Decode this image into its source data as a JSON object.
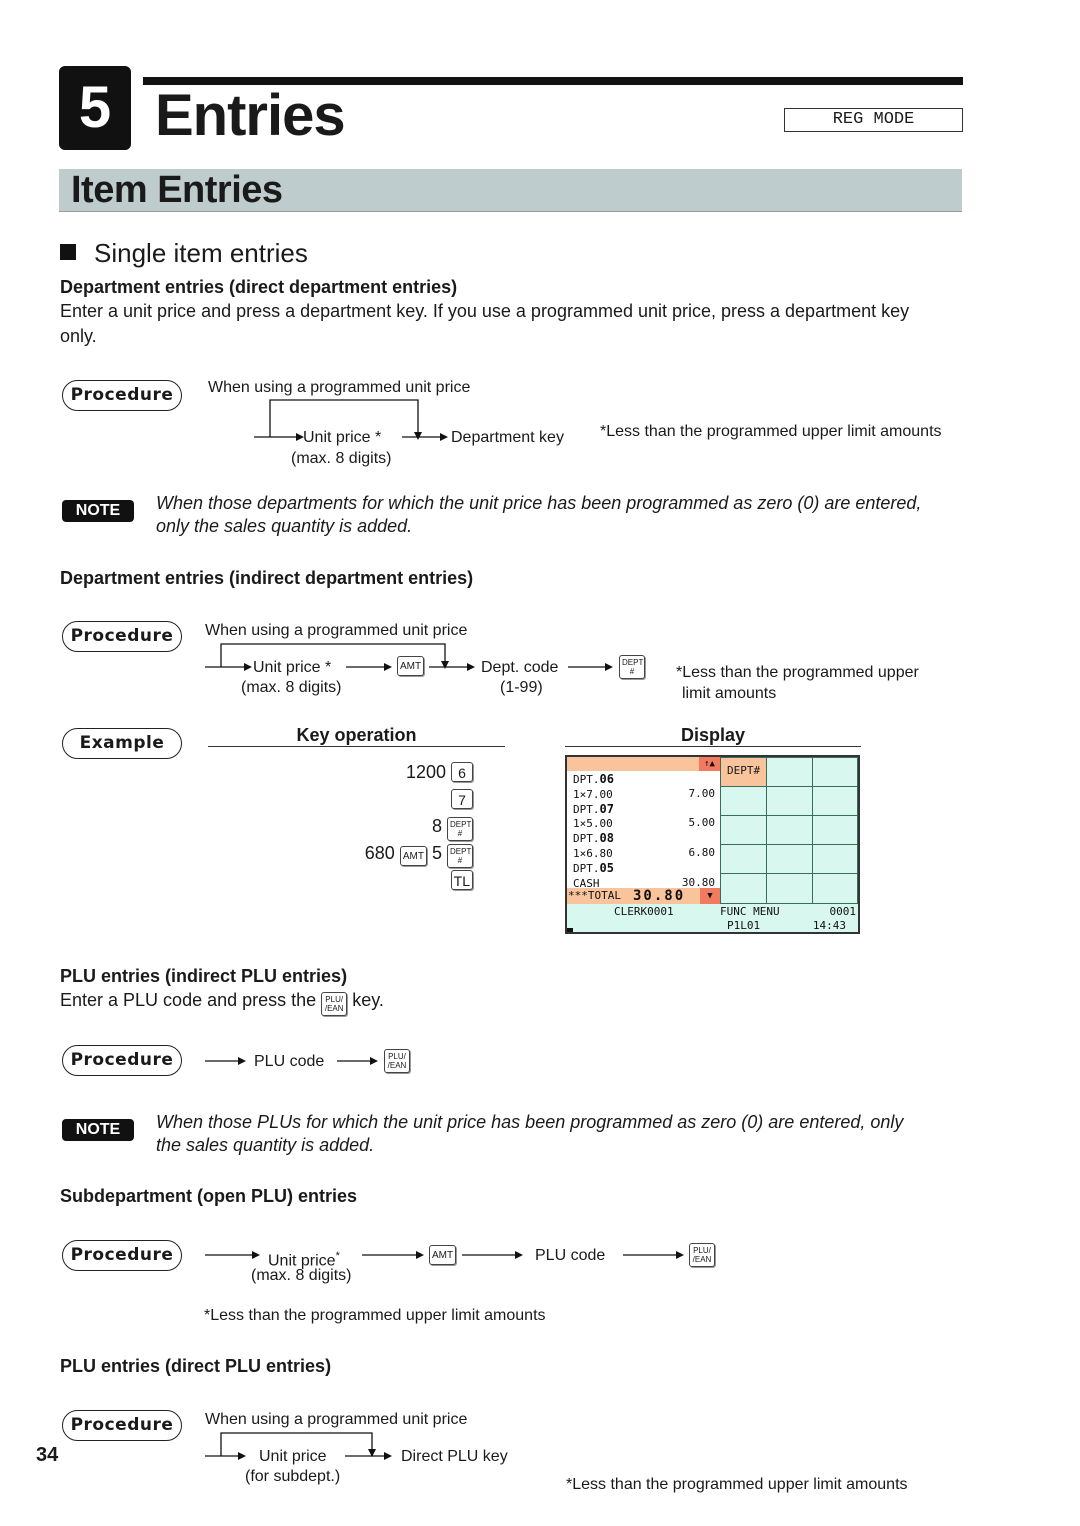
{
  "header": {
    "chapter_number": "5",
    "chapter_title": "Entries",
    "mode": "REG MODE"
  },
  "section": {
    "title": "Item Entries"
  },
  "subsection": {
    "title": "Single item entries"
  },
  "direct_dept": {
    "heading": "Department entries (direct department entries)",
    "body_line1": "Enter a unit price and press a department key.  If you use a programmed unit price, press a department key",
    "body_line2": "only.",
    "procedure_label": "Procedure",
    "bypass_label": "When using a programmed unit price",
    "step1": "Unit price *",
    "step1_sub": "(max. 8 digits)",
    "step2": "Department key",
    "footnote": "*Less than the programmed upper limit amounts",
    "note_label": "NOTE",
    "note_line1": "When those departments for which the unit price has been programmed as zero (0) are entered,",
    "note_line2": "only the sales quantity is added."
  },
  "indirect_dept": {
    "heading": "Department entries (indirect department entries)",
    "procedure_label": "Procedure",
    "bypass_label": "When using a programmed unit price",
    "step1": "Unit price *",
    "step1_sub": "(max. 8 digits)",
    "key_amt": "AMT",
    "step2": "Dept. code",
    "step2_sub": "(1-99)",
    "key_dept_top": "DEPT",
    "key_dept_bottom": "#",
    "footnote_line1": "*Less than the programmed upper",
    "footnote_line2": "limit amounts"
  },
  "example": {
    "label": "Example",
    "key_operation_heading": "Key operation",
    "display_heading": "Display",
    "key_rows": [
      {
        "prefix": "1200",
        "key": "6"
      },
      {
        "prefix": "",
        "key": "7"
      },
      {
        "prefix": "8",
        "key_top": "DEPT",
        "key_bottom": "#"
      },
      {
        "prefix": "680",
        "mid_key": "AMT",
        "mid": "5",
        "key_top": "DEPT",
        "key_bottom": "#"
      },
      {
        "prefix": "",
        "key": "TL"
      }
    ],
    "display": {
      "scroll_up": "↑▲",
      "lines": [
        {
          "left": "DPT.",
          "big": "06",
          "right": ""
        },
        {
          "left": "1×7.00",
          "big": "",
          "right": "7.00"
        },
        {
          "left": "DPT.",
          "big": "07",
          "right": ""
        },
        {
          "left": "1×5.00",
          "big": "",
          "right": "5.00"
        },
        {
          "left": "DPT.",
          "big": "08",
          "right": ""
        },
        {
          "left": "1×6.80",
          "big": "",
          "right": "6.80"
        },
        {
          "left": "DPT.",
          "big": "05",
          "right": ""
        },
        {
          "left": "CASH",
          "big": "",
          "right": "30.80"
        }
      ],
      "total_label": "***TOTAL",
      "total_value": "30.80",
      "scroll_down": "▼",
      "grid_key": "DEPT#",
      "clerk": "CLERK0001",
      "func_menu": "FUNC MENU",
      "counter": "0001",
      "page": "P1L01",
      "time": "14:43"
    }
  },
  "indirect_plu": {
    "heading": "PLU entries (indirect PLU entries)",
    "body_before": "Enter a PLU code and press the",
    "body_after": "key.",
    "key_top": "PLU/",
    "key_bottom": "/EAN",
    "procedure_label": "Procedure",
    "step1": "PLU code",
    "note_label": "NOTE",
    "note_line1": "When those PLUs for which the unit price has been programmed as zero (0) are entered, only",
    "note_line2": "the sales quantity is added."
  },
  "subdept": {
    "heading": "Subdepartment (open PLU) entries",
    "procedure_label": "Procedure",
    "step1": "Unit price",
    "step1_star": "*",
    "step1_sub": "(max. 8 digits)",
    "key_amt": "AMT",
    "step2": "PLU code",
    "footnote": "*Less than the programmed upper limit amounts"
  },
  "direct_plu": {
    "heading": "PLU entries (direct PLU entries)",
    "procedure_label": "Procedure",
    "bypass_label": "When using a programmed unit price",
    "step1": "Unit price",
    "step1_sub": "(for subdept.)",
    "step2": "Direct PLU key",
    "footnote": "*Less than the programmed upper limit amounts"
  },
  "footer": {
    "page_number": "34"
  }
}
